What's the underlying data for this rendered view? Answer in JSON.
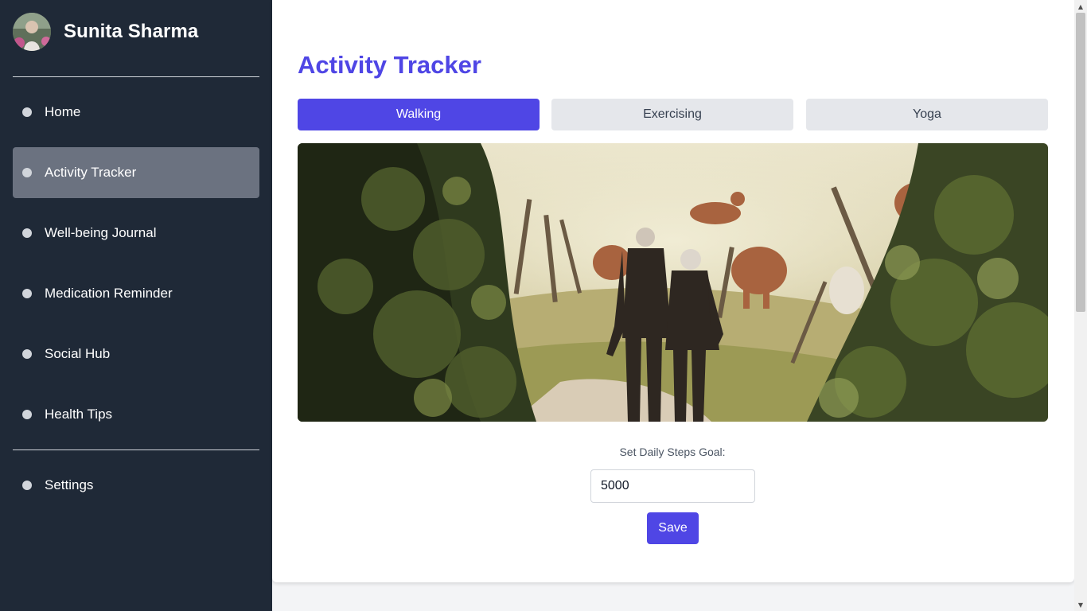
{
  "user": {
    "name": "Sunita Sharma"
  },
  "sidebar": {
    "items": [
      {
        "label": "Home",
        "active": false
      },
      {
        "label": "Activity Tracker",
        "active": true
      },
      {
        "label": "Well-being Journal",
        "active": false
      },
      {
        "label": "Medication Reminder",
        "active": false
      },
      {
        "label": "Social Hub",
        "active": false
      },
      {
        "label": "Health Tips",
        "active": false
      }
    ],
    "footer_items": [
      {
        "label": "Settings"
      }
    ]
  },
  "main": {
    "title": "Activity Tracker",
    "tabs": [
      {
        "label": "Walking",
        "selected": true
      },
      {
        "label": "Exercising",
        "selected": false
      },
      {
        "label": "Yoga",
        "selected": false
      }
    ],
    "goal": {
      "label": "Set Daily Steps Goal:",
      "value": "5000"
    },
    "save_label": "Save"
  },
  "colors": {
    "accent": "#4f46e5",
    "sidebar_bg": "#1f2937",
    "active_nav": "#6b7280"
  }
}
